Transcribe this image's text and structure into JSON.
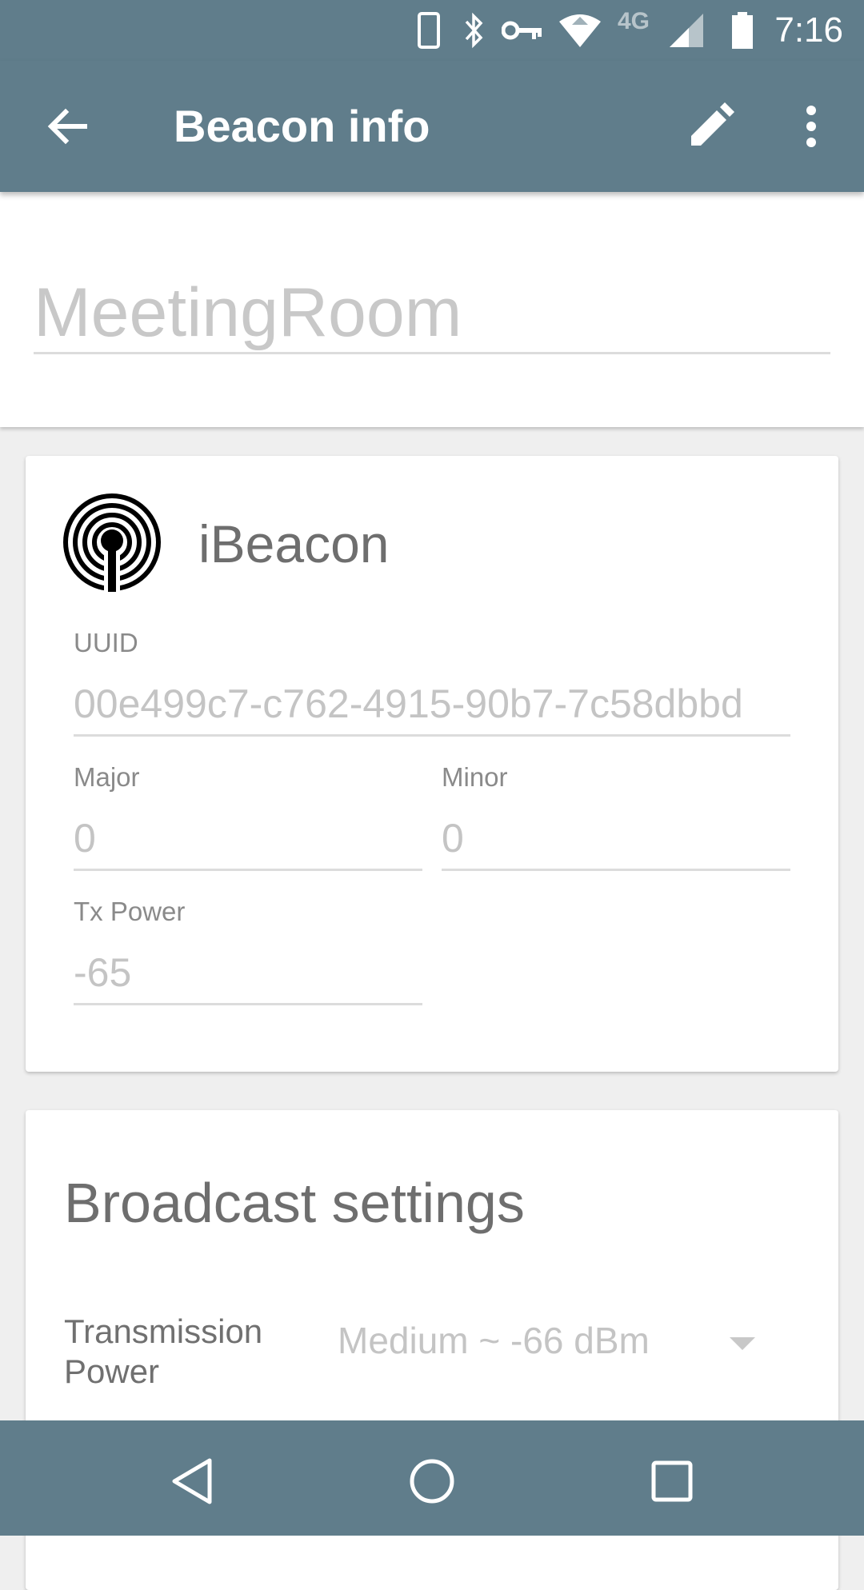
{
  "status_bar": {
    "time": "7:16",
    "network_label": "4G",
    "icons": [
      "phone-icon",
      "bluetooth-icon",
      "key-icon",
      "wifi-icon",
      "cell-signal-icon",
      "battery-icon"
    ]
  },
  "app_bar": {
    "title": "Beacon info",
    "icons": [
      "back-arrow-icon",
      "edit-pencil-icon",
      "more-vert-icon"
    ]
  },
  "beacon_name": {
    "value": "MeetingRoom"
  },
  "ibeacon_card": {
    "title": "iBeacon",
    "icon": "beacon-signal-icon",
    "uuid_label": "UUID",
    "uuid_value": "00e499c7-c762-4915-90b7-7c58dbbd",
    "major_label": "Major",
    "major_value": "0",
    "minor_label": "Minor",
    "minor_value": "0",
    "tx_power_label": "Tx Power",
    "tx_power_value": "-65"
  },
  "broadcast_card": {
    "title": "Broadcast settings",
    "transmission_power_label": "Transmission Power",
    "transmission_power_value": "Medium ~ -66 dBm"
  },
  "nav_bar": {
    "icons": [
      "back-triangle-icon",
      "home-circle-icon",
      "recents-square-icon"
    ]
  },
  "colors": {
    "primary": "#607d8b",
    "background": "#efefef",
    "card": "#ffffff",
    "hint_text": "#c4c4c4",
    "label_text": "#8a8a8a"
  }
}
